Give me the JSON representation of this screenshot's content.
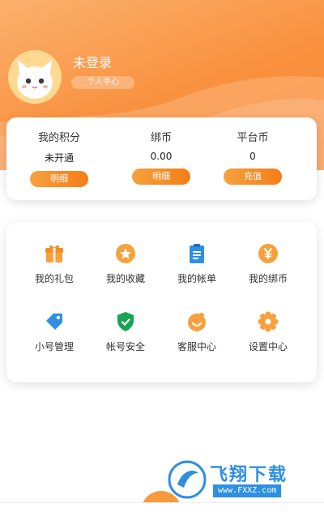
{
  "profile": {
    "username": "未登录",
    "center_button": "个人中心"
  },
  "points": [
    {
      "label": "我的积分",
      "value": "未开通",
      "action": "明细"
    },
    {
      "label": "绑币",
      "value": "0.00",
      "action": "明细"
    },
    {
      "label": "平台币",
      "value": "0",
      "action": "充值"
    }
  ],
  "menu": [
    {
      "label": "我的礼包",
      "icon": "gift-icon"
    },
    {
      "label": "我的收藏",
      "icon": "star-icon"
    },
    {
      "label": "我的帐单",
      "icon": "bill-icon"
    },
    {
      "label": "我的绑币",
      "icon": "yen-icon"
    },
    {
      "label": "小号管理",
      "icon": "tag-icon"
    },
    {
      "label": "帐号安全",
      "icon": "shield-icon"
    },
    {
      "label": "客服中心",
      "icon": "service-icon"
    },
    {
      "label": "设置中心",
      "icon": "gear-icon"
    }
  ],
  "watermark": {
    "title": "飞翔下载",
    "url": "www.FXXZ.com"
  },
  "colors": {
    "accent": "#f98b35",
    "icon_orange": "#f7a13e",
    "icon_blue": "#2f8fe0",
    "icon_green": "#18a553"
  }
}
